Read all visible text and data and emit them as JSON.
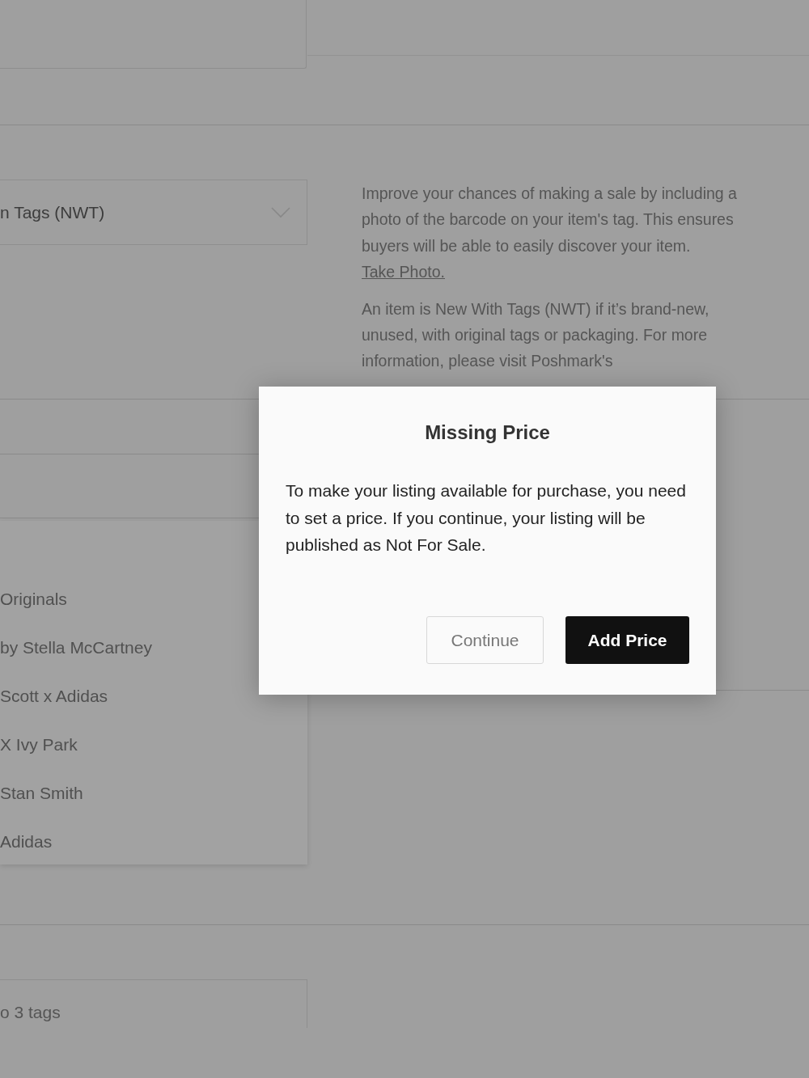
{
  "condition_select": {
    "value": "n Tags (NWT)"
  },
  "info": {
    "barcode_text": "Improve your chances of making a sale by including a photo of the barcode on your item's tag. This ensures buyers will be able to easily discover your item.",
    "barcode_link": "Take Photo.",
    "nwt_text": "An item is New With Tags (NWT) if it’s brand-new, unused, with original tags or packaging. For more information, please visit Poshmark's"
  },
  "brand_dropdown": {
    "options": [
      "Originals",
      "by Stella McCartney",
      "Scott x Adidas",
      "X Ivy Park",
      "Stan Smith",
      "Adidas"
    ]
  },
  "tags_field": {
    "placeholder": "o 3 tags"
  },
  "dialog": {
    "title": "Missing Price",
    "message": "To make your listing available for purchase, you need to set a price. If you continue, your listing will be published as Not For Sale.",
    "buttons": [
      {
        "label": "Continue",
        "kind": "secondary"
      },
      {
        "label": "Add Price",
        "kind": "primary"
      }
    ]
  }
}
